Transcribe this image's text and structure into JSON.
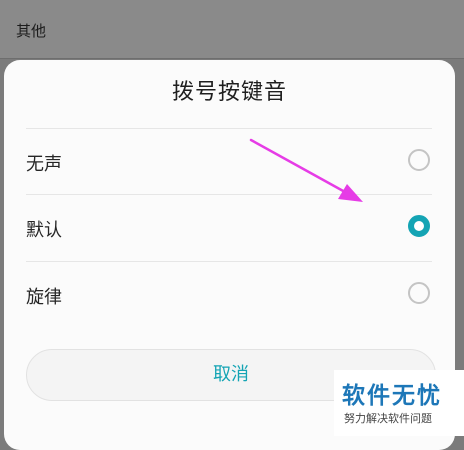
{
  "background": {
    "section_label": "其他"
  },
  "dialog": {
    "title": "拨号按键音",
    "options": [
      {
        "label": "无声",
        "selected": false
      },
      {
        "label": "默认",
        "selected": true
      },
      {
        "label": "旋律",
        "selected": false
      }
    ],
    "cancel_label": "取消"
  },
  "watermark": {
    "title": "软件无忧",
    "subtitle": "努力解决软件问题"
  },
  "colors": {
    "accent": "#14a4b4",
    "arrow": "#e63ce6",
    "watermark_text": "#1d77b8"
  }
}
